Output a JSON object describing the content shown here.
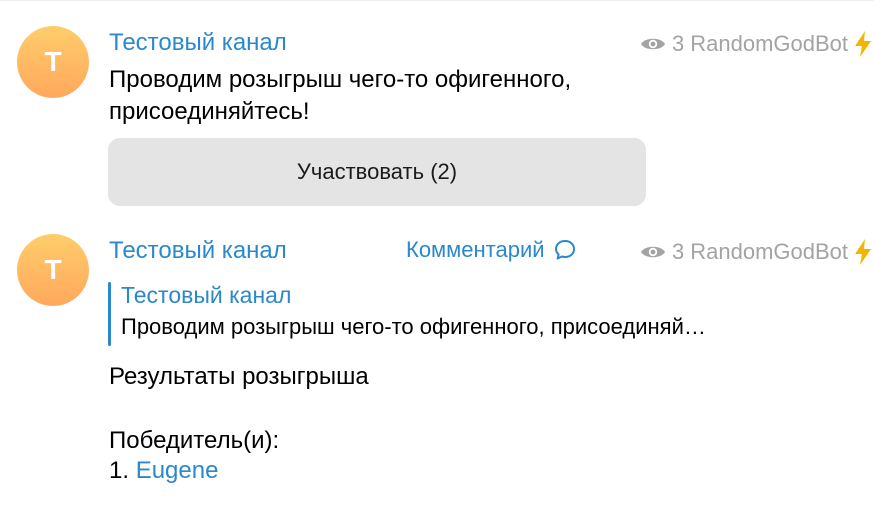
{
  "colors": {
    "accent": "#2b88cc",
    "avatar_top": "#ffcd6b",
    "avatar_bottom": "#ffa85c",
    "meta_gray": "#a3a3a3",
    "button_bg": "#e4e4e4",
    "bolt": "#f5b400"
  },
  "messages": [
    {
      "avatar_letter": "T",
      "author": "Тестовый канал",
      "views": "3",
      "via": "RandomGodBot",
      "text_lines": [
        "Проводим розыгрыш чего-то офигенного,",
        "присоединяйтесь!"
      ],
      "button_label": "Участвовать (2)",
      "icons": {
        "views": "eye-icon",
        "bot": "lightning-icon"
      }
    },
    {
      "avatar_letter": "T",
      "author": "Тестовый канал",
      "comment_label": "Комментарий",
      "views": "3",
      "via": "RandomGodBot",
      "reply": {
        "author": "Тестовый канал",
        "text": "Проводим розыгрыш чего-то офигенного, присоединяй…"
      },
      "result_title": "Результаты розыгрыша",
      "winners_label": "Победитель(и):",
      "winners": [
        {
          "number": "1.",
          "name": "Eugene"
        }
      ],
      "icons": {
        "comment": "comment-bubble-icon",
        "views": "eye-icon",
        "bot": "lightning-icon"
      }
    }
  ]
}
